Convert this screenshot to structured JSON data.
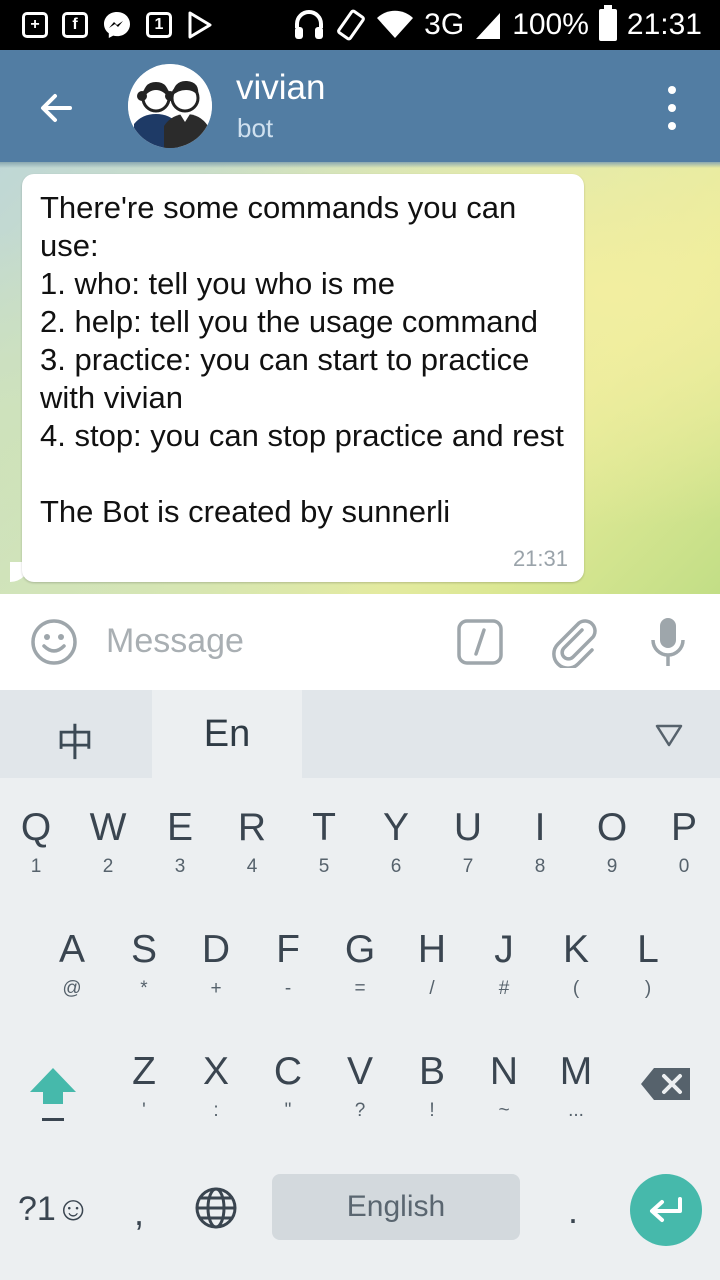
{
  "status_bar": {
    "network": "3G",
    "battery": "100%",
    "time": "21:31",
    "notification_icons": [
      "plus-icon",
      "facebook-icon",
      "messenger-icon",
      "calendar-icon",
      "play-store-icon"
    ],
    "calendar_day": "1"
  },
  "header": {
    "title": "vivian",
    "subtitle": "bot",
    "back_icon": "arrow-left-icon",
    "menu_icon": "more-vert-icon"
  },
  "chat": {
    "messages": [
      {
        "text": "There're some commands you can use:\n1. who: tell you who is me\n2. help: tell you the usage command\n3. practice: you can start to practice with vivian\n4. stop: you can stop practice and rest\n\nThe Bot is created by sunnerli",
        "time": "21:31"
      }
    ]
  },
  "input": {
    "placeholder": "Message"
  },
  "keyboard": {
    "lang_zh": "中",
    "lang_en": "En",
    "rows": [
      [
        {
          "k": "Q",
          "s": "1"
        },
        {
          "k": "W",
          "s": "2"
        },
        {
          "k": "E",
          "s": "3"
        },
        {
          "k": "R",
          "s": "4"
        },
        {
          "k": "T",
          "s": "5"
        },
        {
          "k": "Y",
          "s": "6"
        },
        {
          "k": "U",
          "s": "7"
        },
        {
          "k": "I",
          "s": "8"
        },
        {
          "k": "O",
          "s": "9"
        },
        {
          "k": "P",
          "s": "0"
        }
      ],
      [
        {
          "k": "A",
          "s": "@"
        },
        {
          "k": "S",
          "s": "*"
        },
        {
          "k": "D",
          "s": "+"
        },
        {
          "k": "F",
          "s": "-"
        },
        {
          "k": "G",
          "s": "="
        },
        {
          "k": "H",
          "s": "/"
        },
        {
          "k": "J",
          "s": "#"
        },
        {
          "k": "K",
          "s": "("
        },
        {
          "k": "L",
          "s": ")"
        }
      ],
      [
        {
          "k": "Z",
          "s": "'"
        },
        {
          "k": "X",
          "s": ":"
        },
        {
          "k": "C",
          "s": "\""
        },
        {
          "k": "V",
          "s": "?"
        },
        {
          "k": "B",
          "s": "!"
        },
        {
          "k": "N",
          "s": "~"
        },
        {
          "k": "M",
          "s": "..."
        }
      ]
    ],
    "symbols_key": "?1☺",
    "comma_key": ",",
    "space_label": "English",
    "period_key": ".",
    "accent_color": "#46b9ab"
  }
}
